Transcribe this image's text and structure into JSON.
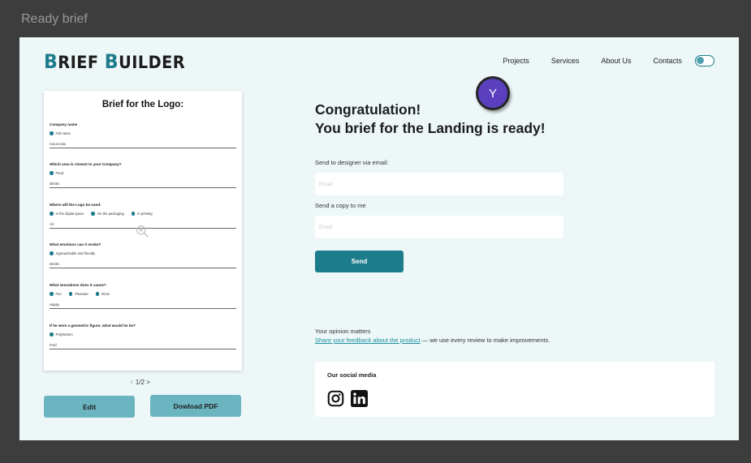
{
  "frame_title": "Ready brief",
  "header": {
    "logo": {
      "first_initial": "B",
      "first_rest": "RIEF ",
      "second_initial": "B",
      "second_rest": "UILDER"
    },
    "nav": [
      "Projects",
      "Services",
      "About Us",
      "Contacts"
    ]
  },
  "preview": {
    "title": "Brief for the Logo:",
    "questions": [
      {
        "question": "Company name",
        "options": [
          "Full name"
        ],
        "answer": "Coca-Cola"
      },
      {
        "question": "Which area is closest to your Company?",
        "options": [
          "Food"
        ],
        "answer": "Drinks"
      },
      {
        "question": "Where will the Logo be used:",
        "options": [
          "In the digital space",
          "On the packaging",
          "In printing"
        ],
        "answer": "All"
      },
      {
        "question": "What emotions can it evoke?",
        "options": [
          "Approachable and friendly"
        ],
        "answer": "Drinks"
      },
      {
        "question": "What sensations does it cause?",
        "options": [
          "Fun",
          "Pleasure",
          "Drive"
        ],
        "answer": "Happy"
      },
      {
        "question": "If he were a geometric figure, what would he be?",
        "options": [
          "Polyhedron"
        ],
        "answer": "Ford"
      }
    ],
    "pager": {
      "prev": "<",
      "page": "1/2",
      "next": ">"
    },
    "edit_label": "Edit",
    "pdf_label": "Dowload PDF"
  },
  "avatar": {
    "initial": "Y"
  },
  "main": {
    "heading_line1": "Congratulation!",
    "heading_line2": "You brief for the Landing is ready!",
    "designer_label": "Send to designer via email:",
    "designer_placeholder": "Email",
    "copy_label": "Send a copy to me",
    "copy_placeholder": "Email",
    "send_label": "Send",
    "opinion_title": "Your opinion matters",
    "opinion_link": "Share your feedback about the product",
    "opinion_rest": " — we use every review to make improvements.",
    "social_title": "Our social media",
    "social_icons": [
      "instagram-icon",
      "linkedin-icon"
    ]
  },
  "colors": {
    "accent": "#1d7c8c",
    "button_light": "#6bb5c1",
    "background": "#edf7f8",
    "avatar": "#5a3fbf"
  }
}
